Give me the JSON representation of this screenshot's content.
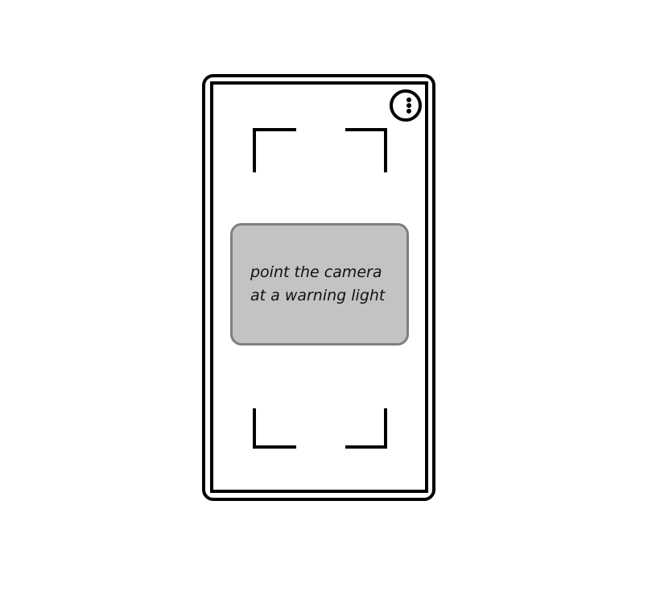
{
  "hint": {
    "line1": "point the camera",
    "line2": "at a warning light"
  },
  "icons": {
    "menu": "more-vertical-icon"
  },
  "colors": {
    "frame": "#000000",
    "hint_background": "#c3c3c3",
    "hint_border": "#7f7f7f",
    "screen_background": "#ffffff"
  }
}
